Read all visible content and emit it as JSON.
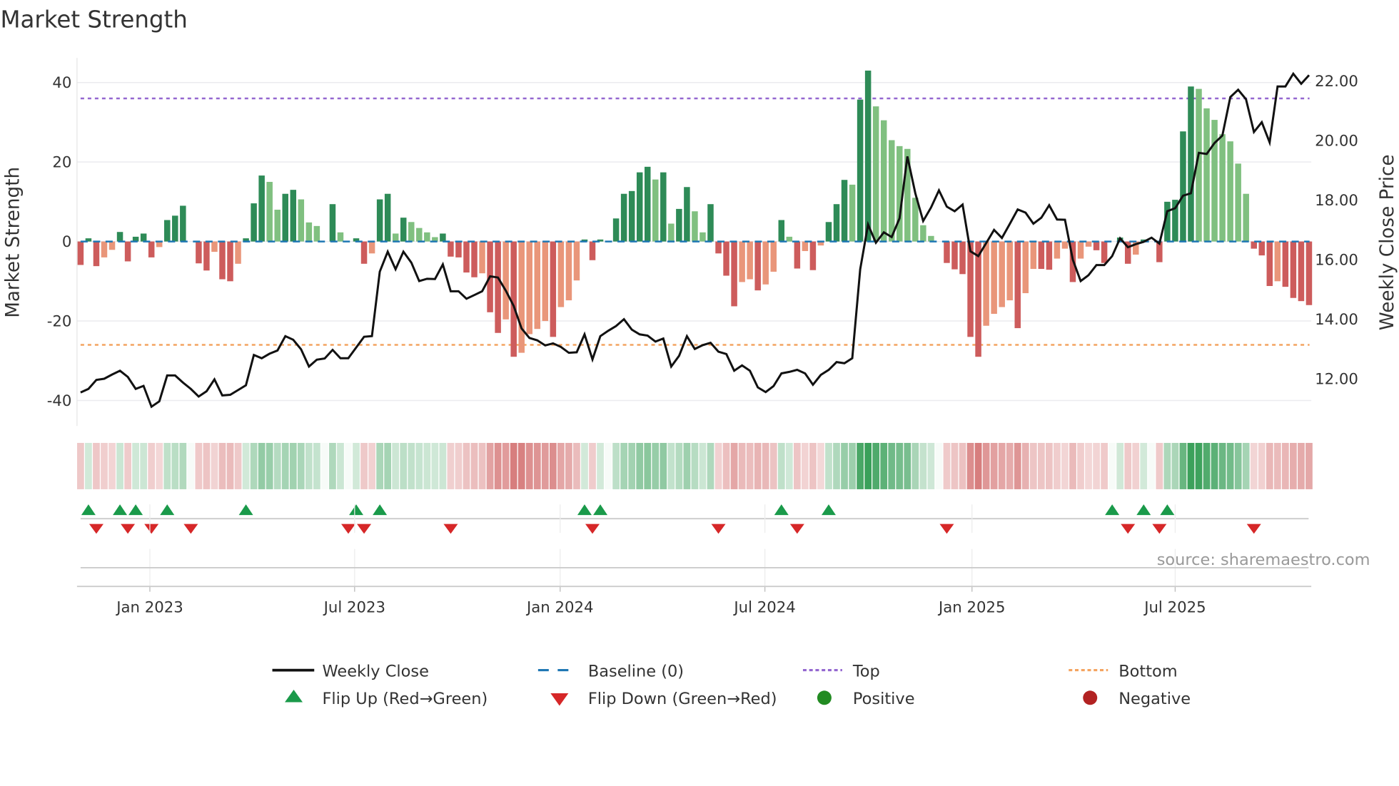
{
  "chart_data": {
    "type": "bar",
    "title": "Market Strength",
    "ylabel": "Market Strength",
    "y2label": "Weekly Close Price",
    "ylim": [
      -45,
      47
    ],
    "yticks": [
      -40,
      -20,
      0,
      20,
      40
    ],
    "y2ticks": [
      "12.00",
      "14.00",
      "16.00",
      "18.00",
      "20.00",
      "22.00"
    ],
    "top": 36,
    "bottom": -26,
    "baseline": 0,
    "xticks": [
      {
        "label": "Jan 2023",
        "week": 8.8
      },
      {
        "label": "Jul 2023",
        "week": 34.8
      },
      {
        "label": "Jan 2024",
        "week": 60.9
      },
      {
        "label": "Jul 2024",
        "week": 86.9
      },
      {
        "label": "Jan 2025",
        "week": 113.2
      },
      {
        "label": "Jul 2025",
        "week": 139.0
      }
    ],
    "strength": [
      -5.9,
      0.8,
      -6.2,
      -4,
      -2.1,
      2.4,
      -5,
      1.2,
      2,
      -4,
      -1.4,
      5.4,
      6.5,
      9,
      0,
      -5.5,
      -7.3,
      -2.6,
      -9.5,
      -10,
      -5.6,
      0.8,
      9.6,
      16.6,
      15,
      8,
      12,
      13,
      10.6,
      4.8,
      3.9,
      0,
      9.4,
      2.3,
      0,
      0.8,
      -5.6,
      -3,
      10.6,
      12,
      2,
      6,
      4.9,
      3.4,
      2.3,
      1.1,
      2,
      -3.8,
      -4,
      -7.8,
      -9,
      -8,
      -17.8,
      -23,
      -19.6,
      -29,
      -28,
      -23.3,
      -22,
      -20,
      -24,
      -16.5,
      -14.8,
      -9.8,
      0.5,
      -4.7,
      0.5,
      0,
      5.8,
      12,
      12.7,
      17.4,
      18.8,
      15.6,
      17.4,
      4.5,
      8.2,
      13.7,
      7.6,
      2.3,
      9.4,
      -3,
      -8.6,
      -16.3,
      -10.2,
      -9.5,
      -12.3,
      -10.8,
      -7.6,
      5.4,
      1.2,
      -6.8,
      -2.4,
      -7.2,
      -1,
      4.9,
      9.4,
      15.5,
      14.3,
      35.7,
      43,
      34,
      30.5,
      25.5,
      24,
      23.3,
      11,
      4.1,
      1.4,
      0,
      -5.4,
      -7,
      -8.2,
      -24,
      -29,
      -21.2,
      -18.2,
      -16.5,
      -14.8,
      -21.8,
      -13,
      -6.9,
      -6.9,
      -7.1,
      -4.3,
      -1.8,
      -10.2,
      -4.3,
      -1.3,
      -2.2,
      -5.4,
      0,
      1,
      -5.6,
      -3.3,
      0.5,
      0,
      -5.2,
      10,
      10.5,
      27.7,
      39,
      38.4,
      33.5,
      30.6,
      27,
      25.2,
      19.6,
      12,
      -1.8,
      -3.5,
      -11.2,
      -10,
      -11.4,
      -14.2,
      -15,
      -16
    ],
    "weekly_close": [
      11.54,
      11.66,
      11.96,
      12.0,
      12.14,
      12.27,
      12.06,
      11.66,
      11.76,
      11.06,
      11.24,
      12.11,
      12.11,
      11.87,
      11.66,
      11.4,
      11.58,
      11.98,
      11.44,
      11.46,
      11.62,
      11.78,
      12.8,
      12.69,
      12.84,
      12.95,
      13.43,
      13.31,
      12.99,
      12.41,
      12.64,
      12.68,
      12.97,
      12.69,
      12.69,
      13.05,
      13.41,
      13.43,
      15.6,
      16.27,
      15.68,
      16.27,
      15.9,
      15.28,
      15.36,
      15.35,
      15.84,
      14.94,
      14.94,
      14.69,
      14.81,
      14.94,
      15.44,
      15.4,
      14.96,
      14.45,
      13.69,
      13.37,
      13.29,
      13.12,
      13.19,
      13.07,
      12.87,
      12.89,
      13.49,
      12.65,
      13.43,
      13.61,
      13.77,
      14.0,
      13.65,
      13.49,
      13.45,
      13.25,
      13.35,
      12.41,
      12.77,
      13.43,
      13.0,
      13.13,
      13.21,
      12.91,
      12.83,
      12.27,
      12.45,
      12.27,
      11.71,
      11.55,
      11.75,
      12.18,
      12.23,
      12.3,
      12.18,
      11.8,
      12.13,
      12.3,
      12.56,
      12.52,
      12.69,
      15.68,
      17.18,
      16.57,
      16.92,
      16.76,
      17.39,
      19.47,
      18.23,
      17.3,
      17.75,
      18.33,
      17.78,
      17.63,
      17.85,
      16.28,
      16.12,
      16.56,
      17.0,
      16.73,
      17.2,
      17.69,
      17.58,
      17.21,
      17.41,
      17.83,
      17.35,
      17.34,
      16.0,
      15.28,
      15.48,
      15.82,
      15.82,
      16.12,
      16.72,
      16.42,
      16.52,
      16.6,
      16.74,
      16.54,
      17.63,
      17.73,
      18.15,
      18.23,
      19.59,
      19.55,
      19.92,
      20.17,
      21.46,
      21.71,
      21.39,
      20.29,
      20.62,
      19.94,
      21.82,
      21.82,
      22.25,
      21.91,
      22.2
    ],
    "flip_up_weeks": [
      1,
      5,
      7,
      11,
      21,
      35,
      38,
      64,
      66,
      89,
      95,
      131,
      135,
      138
    ],
    "flip_down_weeks": [
      2,
      6,
      9,
      14,
      34,
      36,
      47,
      65,
      81,
      91,
      110,
      133,
      137,
      149
    ],
    "legend": {
      "placement": "bottom",
      "items": [
        {
          "key": "close",
          "label": "Weekly Close"
        },
        {
          "key": "baseline",
          "label": "Baseline (0)"
        },
        {
          "key": "top",
          "label": "Top"
        },
        {
          "key": "bottom",
          "label": "Bottom"
        },
        {
          "key": "flipup",
          "label": "Flip Up (Red→Green)"
        },
        {
          "key": "flipdown",
          "label": "Flip Down (Green→Red)"
        },
        {
          "key": "positive",
          "label": "Positive"
        },
        {
          "key": "negative",
          "label": "Negative"
        }
      ]
    },
    "source": "source: sharemaestro.com",
    "colors": {
      "pos_strong": "#2e8b57",
      "pos_weak": "#80c080",
      "neg_strong": "#cd5c5c",
      "neg_weak": "#e9967a",
      "close": "#111111",
      "baseline": "#1f77b4",
      "top": "#9467d0",
      "bottom": "#f4a460",
      "flipup": "#1a9a4a",
      "flipdown": "#d62728",
      "positive": "#228b22",
      "negative": "#b22222"
    }
  }
}
